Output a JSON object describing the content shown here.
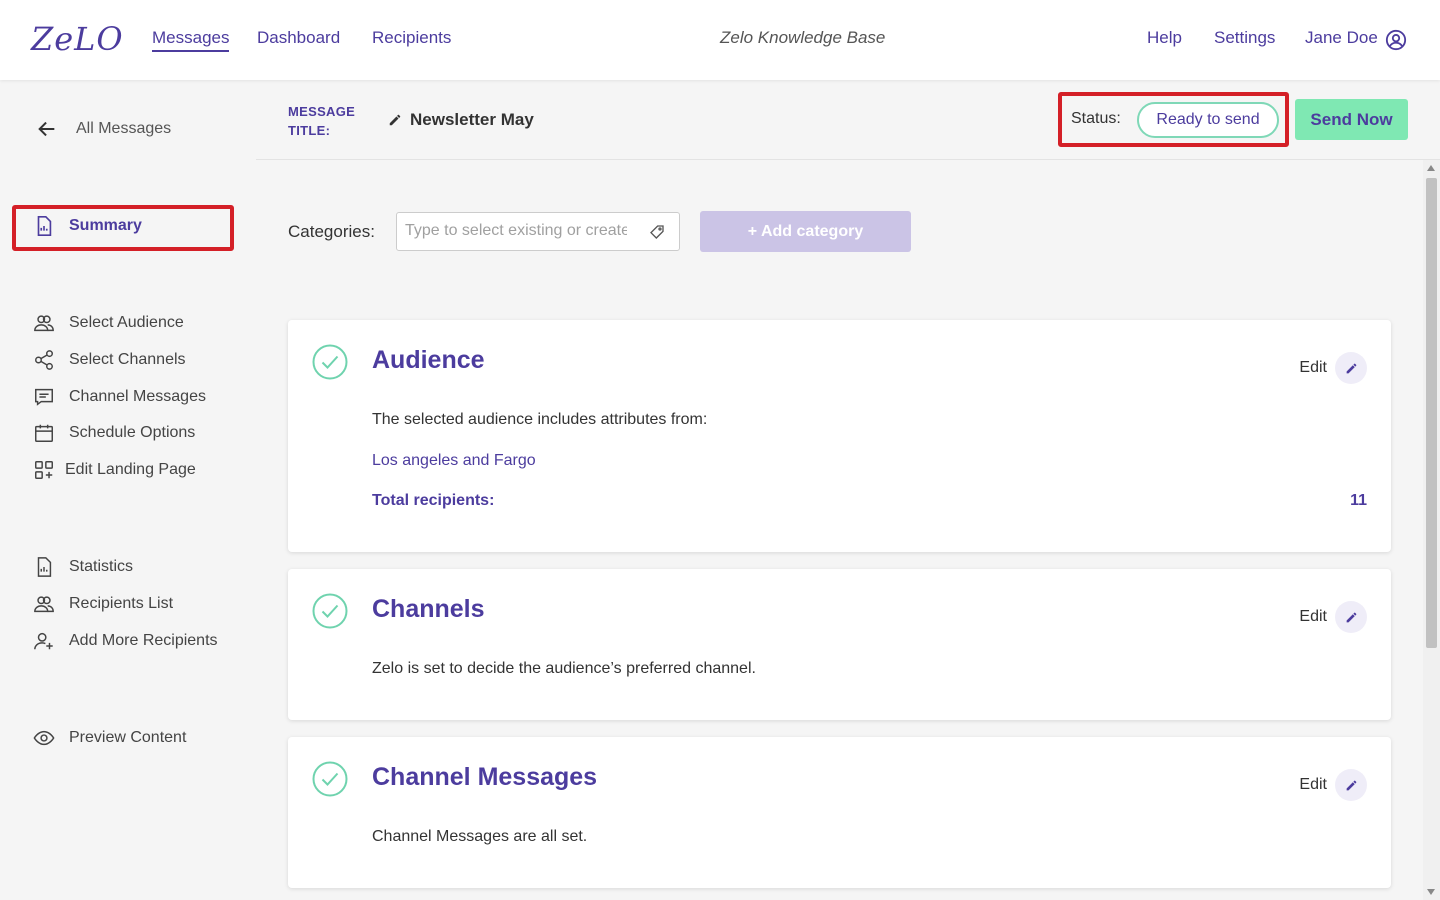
{
  "nav": {
    "logo": "ZeLO",
    "links": [
      "Messages",
      "Dashboard",
      "Recipients"
    ],
    "knowledge_base": "Zelo Knowledge Base",
    "right_links": [
      "Help",
      "Settings"
    ],
    "user_name": "Jane Doe"
  },
  "sidebar": {
    "back_label": "All Messages",
    "summary": "Summary",
    "group1": [
      "Select Audience",
      "Select Channels",
      "Channel Messages",
      "Schedule Options",
      "Edit Landing Page"
    ],
    "group2": [
      "Statistics",
      "Recipients List",
      "Add More Recipients"
    ],
    "preview": "Preview Content"
  },
  "header": {
    "title_label_line1": "MESSAGE",
    "title_label_line2": "TITLE:",
    "title_value": "Newsletter May",
    "status_label": "Status:",
    "status_value": "Ready to send",
    "send_button": "Send Now"
  },
  "categories": {
    "label": "Categories:",
    "placeholder": "Type to select existing or create new",
    "add_button": "+ Add category"
  },
  "cards": {
    "audience": {
      "title": "Audience",
      "edit": "Edit",
      "description": "The selected audience includes attributes from:",
      "attributes": "Los angeles and Fargo",
      "total_label": "Total recipients:",
      "total_value": "11"
    },
    "channels": {
      "title": "Channels",
      "edit": "Edit",
      "description": "Zelo is set to decide the audience’s preferred channel."
    },
    "channel_messages": {
      "title": "Channel Messages",
      "edit": "Edit",
      "description": "Channel Messages are all set."
    }
  },
  "colors": {
    "brand_purple": "#4c3c9e",
    "success_green": "#7fe8b3",
    "highlight_red": "#d42027"
  }
}
